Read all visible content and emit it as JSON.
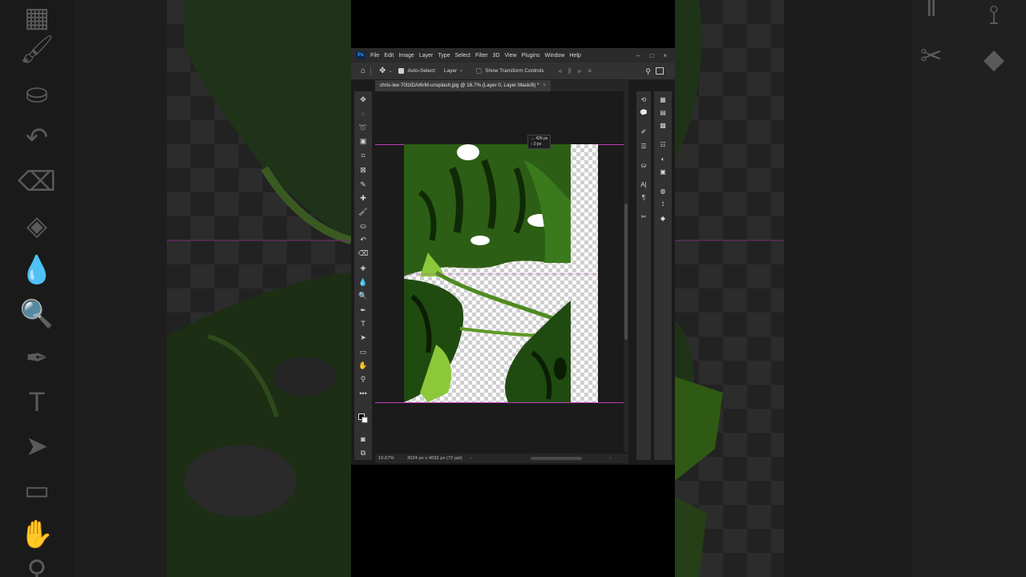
{
  "menu": {
    "logo": "Ps",
    "items": [
      "File",
      "Edit",
      "Image",
      "Layer",
      "Type",
      "Select",
      "Filter",
      "3D",
      "View",
      "Plugins",
      "Window",
      "Help"
    ]
  },
  "window_controls": {
    "minimize": "–",
    "maximize": "□",
    "close": "×"
  },
  "options_bar": {
    "auto_select_label": "Auto-Select:",
    "auto_select_checked": true,
    "target_value": "Layer",
    "show_transform_label": "Show Transform Controls",
    "show_transform_checked": false
  },
  "document": {
    "tab_title": "chris-lee-70l1tDAI6rM-unsplash.jpg @ 16.7% (Layer 0, Layer Mask/8) *",
    "close_glyph": "×"
  },
  "tooltip": {
    "line1": "↔ 426 px",
    "line2": "↕  0 px"
  },
  "status": {
    "zoom": "16.67%",
    "doc_info": "3024 px x 4032 px (72 ppi)",
    "arrow_right": "›",
    "arrow_left": "‹"
  },
  "tools": [
    {
      "name": "move-tool",
      "glyph": "✥"
    },
    {
      "name": "marquee-tool",
      "glyph": "◌"
    },
    {
      "name": "lasso-tool",
      "glyph": "➰"
    },
    {
      "name": "object-select-tool",
      "glyph": "▣"
    },
    {
      "name": "crop-tool",
      "glyph": "⌗"
    },
    {
      "name": "frame-tool",
      "glyph": "⊠"
    },
    {
      "name": "eyedropper-tool",
      "glyph": "✎"
    },
    {
      "name": "healing-brush-tool",
      "glyph": "✚"
    },
    {
      "name": "brush-tool",
      "glyph": "🖌"
    },
    {
      "name": "clone-stamp-tool",
      "glyph": "⛀"
    },
    {
      "name": "history-brush-tool",
      "glyph": "↶"
    },
    {
      "name": "eraser-tool",
      "glyph": "⌫"
    },
    {
      "name": "paint-bucket-tool",
      "glyph": "◈"
    },
    {
      "name": "blur-tool",
      "glyph": "💧"
    },
    {
      "name": "dodge-tool",
      "glyph": "🔍"
    },
    {
      "name": "pen-tool",
      "glyph": "✒"
    },
    {
      "name": "type-tool",
      "glyph": "T"
    },
    {
      "name": "path-select-tool",
      "glyph": "➤"
    },
    {
      "name": "rectangle-tool",
      "glyph": "▭"
    },
    {
      "name": "hand-tool",
      "glyph": "✋"
    },
    {
      "name": "zoom-tool",
      "glyph": "⚲"
    },
    {
      "name": "more-tools",
      "glyph": "•••"
    }
  ],
  "bottom_tools": [
    {
      "name": "quick-mask-icon",
      "glyph": "◙"
    },
    {
      "name": "screen-mode-icon",
      "glyph": "⧉"
    }
  ],
  "panels_col1": [
    {
      "name": "history-panel-icon",
      "glyph": "⟲"
    },
    {
      "name": "comments-panel-icon",
      "glyph": "💬"
    },
    {
      "name": "brush-settings-icon",
      "glyph": "✐"
    },
    {
      "name": "properties-panel-icon",
      "glyph": "☰"
    },
    {
      "name": "clone-source-icon",
      "glyph": "⛀"
    },
    {
      "name": "character-panel-icon",
      "glyph": "A|"
    },
    {
      "name": "paragraph-panel-icon",
      "glyph": "¶"
    },
    {
      "name": "tools-panel-icon",
      "glyph": "✂"
    }
  ],
  "panels_col2": [
    {
      "name": "swatches-panel-icon",
      "glyph": "▦"
    },
    {
      "name": "gradients-panel-icon",
      "glyph": "▤"
    },
    {
      "name": "patterns-panel-icon",
      "glyph": "▩"
    },
    {
      "name": "adjustments-panel-icon",
      "glyph": "☷"
    },
    {
      "name": "libraries-panel-icon",
      "glyph": "◐"
    },
    {
      "name": "styles-panel-icon",
      "glyph": "▣"
    },
    {
      "name": "channels-panel-icon",
      "glyph": "◍"
    },
    {
      "name": "paths-panel-icon",
      "glyph": "⟟"
    },
    {
      "name": "layers-panel-icon",
      "glyph": "◆"
    }
  ],
  "colors": {
    "guide": "#c23dbd",
    "leaf_dark": "#1f4a10",
    "leaf_mid": "#3c7a1a",
    "leaf_light": "#8cc83a"
  }
}
